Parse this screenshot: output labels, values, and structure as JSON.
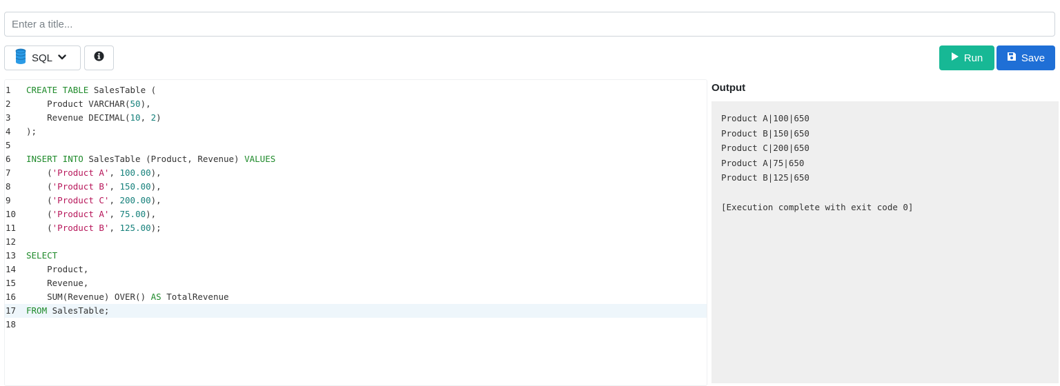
{
  "title_input": {
    "placeholder": "Enter a title...",
    "value": ""
  },
  "toolbar": {
    "language_label": "SQL",
    "run_label": "Run",
    "save_label": "Save",
    "icons": {
      "language": "database-icon",
      "dropdown": "chevron-down-icon",
      "info": "info-icon",
      "run": "play-icon",
      "save": "floppy-disk-icon"
    },
    "colors": {
      "run": "#17b895",
      "save": "#1f6fd6"
    }
  },
  "editor": {
    "active_line": 17,
    "lines": [
      {
        "n": "1",
        "tokens": [
          [
            "kw",
            "CREATE TABLE"
          ],
          [
            "p",
            " SalesTable ("
          ]
        ]
      },
      {
        "n": "2",
        "tokens": [
          [
            "p",
            "    Product VARCHAR("
          ],
          [
            "num",
            "50"
          ],
          [
            "p",
            "),"
          ]
        ]
      },
      {
        "n": "3",
        "tokens": [
          [
            "p",
            "    Revenue DECIMAL("
          ],
          [
            "num",
            "10"
          ],
          [
            "p",
            ", "
          ],
          [
            "num",
            "2"
          ],
          [
            "p",
            ")"
          ]
        ]
      },
      {
        "n": "4",
        "tokens": [
          [
            "p",
            ");"
          ]
        ]
      },
      {
        "n": "5",
        "tokens": []
      },
      {
        "n": "6",
        "tokens": [
          [
            "kw",
            "INSERT INTO"
          ],
          [
            "p",
            " SalesTable (Product, Revenue) "
          ],
          [
            "kw",
            "VALUES"
          ]
        ]
      },
      {
        "n": "7",
        "tokens": [
          [
            "p",
            "    ("
          ],
          [
            "str",
            "'Product A'"
          ],
          [
            "p",
            ", "
          ],
          [
            "num",
            "100.00"
          ],
          [
            "p",
            "),"
          ]
        ]
      },
      {
        "n": "8",
        "tokens": [
          [
            "p",
            "    ("
          ],
          [
            "str",
            "'Product B'"
          ],
          [
            "p",
            ", "
          ],
          [
            "num",
            "150.00"
          ],
          [
            "p",
            "),"
          ]
        ]
      },
      {
        "n": "9",
        "tokens": [
          [
            "p",
            "    ("
          ],
          [
            "str",
            "'Product C'"
          ],
          [
            "p",
            ", "
          ],
          [
            "num",
            "200.00"
          ],
          [
            "p",
            "),"
          ]
        ]
      },
      {
        "n": "10",
        "tokens": [
          [
            "p",
            "    ("
          ],
          [
            "str",
            "'Product A'"
          ],
          [
            "p",
            ", "
          ],
          [
            "num",
            "75.00"
          ],
          [
            "p",
            "),"
          ]
        ]
      },
      {
        "n": "11",
        "tokens": [
          [
            "p",
            "    ("
          ],
          [
            "str",
            "'Product B'"
          ],
          [
            "p",
            ", "
          ],
          [
            "num",
            "125.00"
          ],
          [
            "p",
            ");"
          ]
        ]
      },
      {
        "n": "12",
        "tokens": []
      },
      {
        "n": "13",
        "tokens": [
          [
            "kw",
            "SELECT"
          ]
        ]
      },
      {
        "n": "14",
        "tokens": [
          [
            "p",
            "    Product,"
          ]
        ]
      },
      {
        "n": "15",
        "tokens": [
          [
            "p",
            "    Revenue,"
          ]
        ]
      },
      {
        "n": "16",
        "tokens": [
          [
            "p",
            "    SUM(Revenue) OVER() "
          ],
          [
            "kw",
            "AS"
          ],
          [
            "p",
            " TotalRevenue"
          ]
        ]
      },
      {
        "n": "17",
        "tokens": [
          [
            "kw",
            "FROM"
          ],
          [
            "p",
            " SalesTable;"
          ]
        ]
      },
      {
        "n": "18",
        "tokens": []
      }
    ]
  },
  "output": {
    "label": "Output",
    "lines": [
      "Product A|100|650",
      "Product B|150|650",
      "Product C|200|650",
      "Product A|75|650",
      "Product B|125|650",
      "",
      "[Execution complete with exit code 0]"
    ]
  }
}
